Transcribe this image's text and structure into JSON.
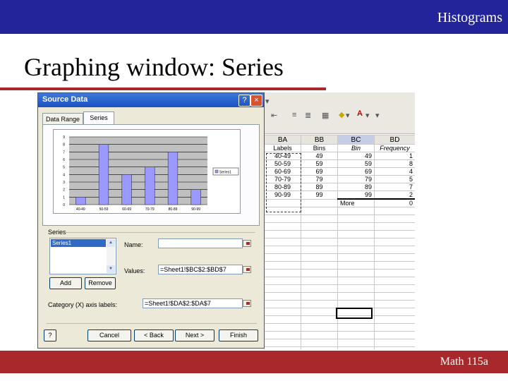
{
  "slide": {
    "header": "Histograms",
    "title": "Graphing window: Series",
    "footer": "Math 115a"
  },
  "dialog": {
    "title": "Source Data",
    "help_button": "?",
    "close_button": "×",
    "tabs": [
      {
        "label": "Data Range"
      },
      {
        "label": "Series"
      }
    ],
    "series_group_label": "Series",
    "series_list": [
      "Series1"
    ],
    "name_label": "Name:",
    "name_value": "",
    "values_label": "Values:",
    "values_value": "=Sheet1!$BC$2:$BD$7",
    "add_button": "Add",
    "remove_button": "Remove",
    "category_label": "Category (X) axis labels:",
    "category_value": "=Sheet1!$DA$2:$DA$7",
    "buttons": {
      "cancel": "Cancel",
      "back": "< Back",
      "next": "Next >",
      "finish": "Finish"
    }
  },
  "chart_data": {
    "type": "bar",
    "categories": [
      "40-49",
      "50-59",
      "60-69",
      "70-79",
      "80-89",
      "90-99"
    ],
    "values": [
      1,
      8,
      4,
      5,
      7,
      2
    ],
    "ylim": [
      0,
      9
    ],
    "yticks": [
      "0",
      "1",
      "2",
      "3",
      "4",
      "5",
      "6",
      "7",
      "8",
      "9"
    ],
    "legend": "Series1",
    "legend_placement": "right",
    "bar_color": "#9999ff",
    "grid": true
  },
  "sheet": {
    "columns": [
      "BA",
      "BB",
      "BC",
      "BD"
    ],
    "selected_column": "BC",
    "header_row": [
      "Labels",
      "Bins",
      "Bin",
      "Frequency"
    ],
    "rows": [
      [
        "40-49",
        "49",
        "49",
        "1"
      ],
      [
        "50-59",
        "59",
        "59",
        "8"
      ],
      [
        "60-69",
        "69",
        "69",
        "4"
      ],
      [
        "70-79",
        "79",
        "79",
        "5"
      ],
      [
        "80-89",
        "89",
        "89",
        "7"
      ],
      [
        "90-99",
        "99",
        "99",
        "2"
      ]
    ],
    "more_row": [
      "",
      "",
      "More",
      "0"
    ]
  }
}
